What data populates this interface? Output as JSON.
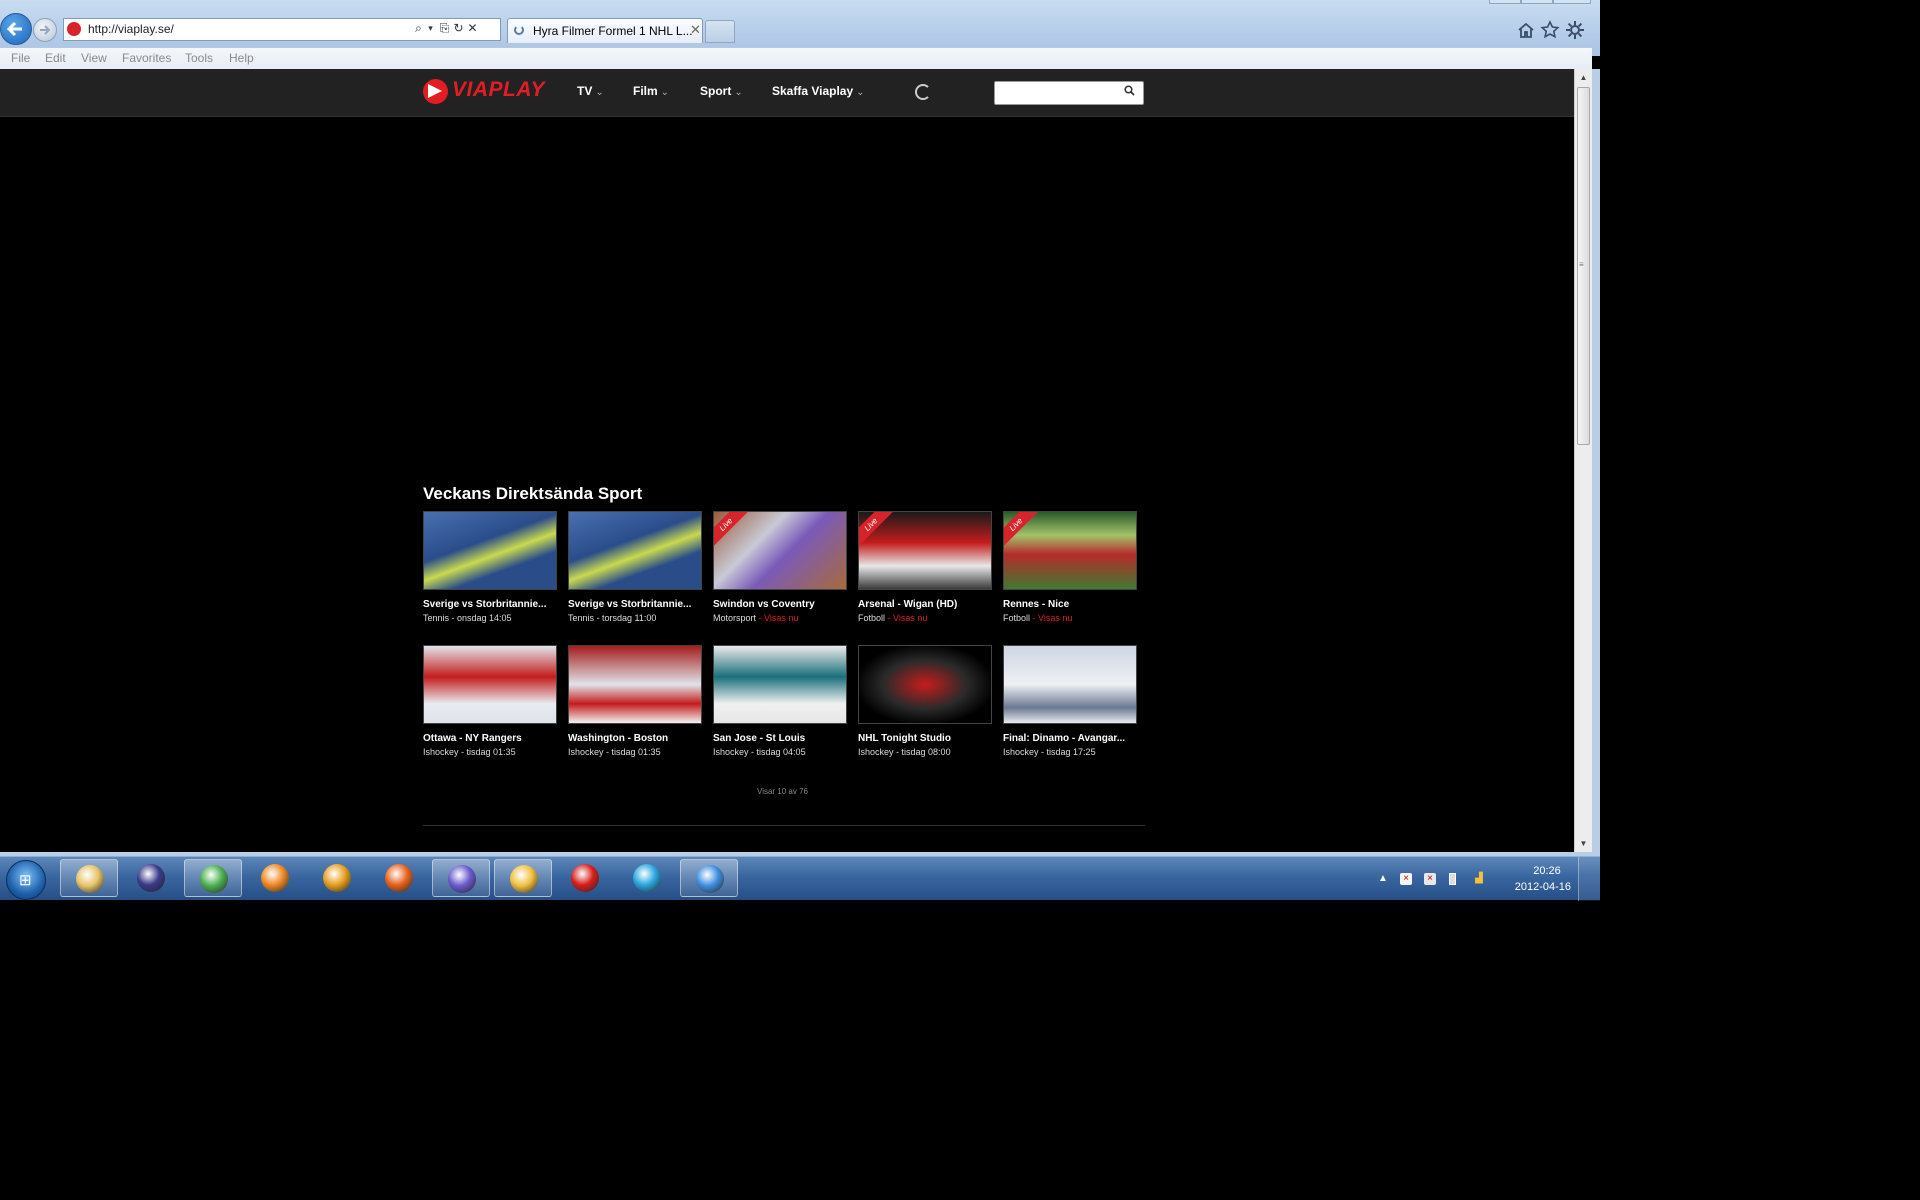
{
  "browser": {
    "url": "http://viaplay.se/",
    "tab_title": "Hyra Filmer Formel 1 NHL L...",
    "tab_close": "✕",
    "address_tools": [
      "⌕",
      "▾",
      "⎘",
      "↻",
      "✕"
    ],
    "toolbar_icons": [
      "home-icon",
      "star-icon",
      "gear-icon"
    ]
  },
  "menubar": {
    "items": [
      "File",
      "Edit",
      "View",
      "Favorites",
      "Tools",
      "Help"
    ]
  },
  "site": {
    "logo_text": "VIAPLAY",
    "brand_color": "#e41d25",
    "nav": [
      "TV",
      "Film",
      "Sport",
      "Skaffa Viaplay"
    ],
    "search_placeholder": ""
  },
  "section": {
    "title": "Veckans Direktsända Sport",
    "cards": [
      {
        "title": "Sverige vs Storbritannie...",
        "category": "Tennis",
        "time": " - onsdag 14:05",
        "live": false,
        "live_label": "",
        "thumb": "tennis-player-icon"
      },
      {
        "title": "Sverige vs Storbritannie...",
        "category": "Tennis",
        "time": " - torsdag 11:00",
        "live": false,
        "live_label": "",
        "thumb": "tennis-player-icon"
      },
      {
        "title": "Swindon vs Coventry",
        "category": "Motorsport",
        "time": " - Visas nu",
        "live": true,
        "live_label": "Live",
        "thumb": "speedway-icon"
      },
      {
        "title": "Arsenal - Wigan (HD)",
        "category": "Fotboll",
        "time": " - Visas nu",
        "live": true,
        "live_label": "Live",
        "thumb": "football-players-icon"
      },
      {
        "title": "Rennes - Nice",
        "category": "Fotboll",
        "time": " - Visas nu",
        "live": true,
        "live_label": "Live",
        "thumb": "football-ball-icon"
      },
      {
        "title": "Ottawa - NY Rangers",
        "category": "Ishockey",
        "time": " - tisdag 01:35",
        "live": false,
        "live_label": "",
        "thumb": "hockey-player-icon"
      },
      {
        "title": "Washington - Boston",
        "category": "Ishockey",
        "time": " - tisdag 01:35",
        "live": false,
        "live_label": "",
        "thumb": "hockey-players-icon"
      },
      {
        "title": "San Jose - St Louis",
        "category": "Ishockey",
        "time": " - tisdag 04:05",
        "live": false,
        "live_label": "",
        "thumb": "hockey-player-icon"
      },
      {
        "title": "NHL Tonight Studio",
        "category": "Ishockey",
        "time": " - tisdag 08:00",
        "live": false,
        "live_label": "",
        "thumb": "nhl-tonight-logo"
      },
      {
        "title": "Final: Dinamo - Avangar...",
        "category": "Ishockey",
        "time": " - tisdag 17:25",
        "live": false,
        "live_label": "",
        "thumb": "hockey-goalie-icon"
      }
    ],
    "pager": "Visar 10 av 76"
  },
  "taskbar": {
    "apps": [
      "windows-explorer-icon",
      "eclipse-icon",
      "chrome-icon",
      "media-player-icon",
      "office-icon",
      "firefox-icon",
      "java-ee-icon",
      "outlook-icon",
      "opera-icon",
      "skype-icon",
      "internet-explorer-icon"
    ],
    "tray": [
      "chevron-up-icon",
      "speaker-muted-icon",
      "network-error-icon",
      "battery-icon",
      "signal-icon"
    ],
    "time": "20:26",
    "date": "2012-04-16"
  }
}
